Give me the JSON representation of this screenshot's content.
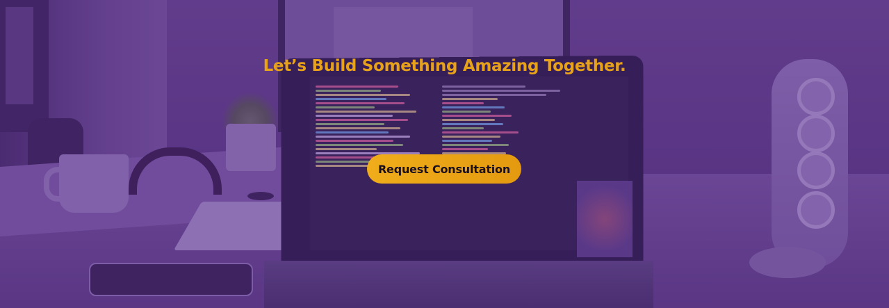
{
  "hero": {
    "headline": "Let’s Build Something Amazing Together.",
    "cta_label": "Request Consultation",
    "colors": {
      "accent": "#e8a21a",
      "overlay": "#582c8c",
      "button_text": "#1a1020"
    },
    "background_scene": "desk-with-laptop-photo"
  }
}
